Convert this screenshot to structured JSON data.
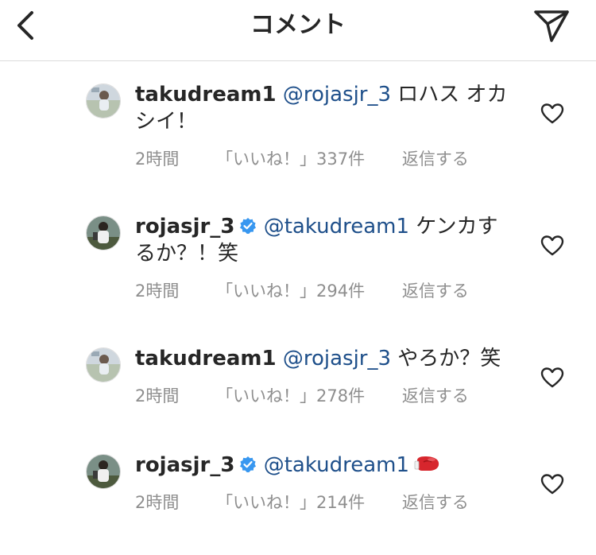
{
  "header": {
    "title": "コメント"
  },
  "comments": [
    {
      "username": "takudream1",
      "verified": false,
      "mention": "@rojasjr_3",
      "text": " ロハス オカシイ！",
      "time": "2時間",
      "likes": "「いいね！」337件",
      "reply": "返信する"
    },
    {
      "username": "rojasjr_3",
      "verified": true,
      "mention": "@takudream1",
      "text": " ケンカするか？！笑",
      "time": "2時間",
      "likes": "「いいね！」294件",
      "reply": "返信する"
    },
    {
      "username": "takudream1",
      "verified": false,
      "mention": "@rojasjr_3",
      "text": " やろか？笑",
      "time": "2時間",
      "likes": "「いいね！」278件",
      "reply": "返信する"
    },
    {
      "username": "rojasjr_3",
      "verified": true,
      "mention": "@takudream1",
      "text": "",
      "emoji": "boxing-glove-icon",
      "time": "2時間",
      "likes": "「いいね！」214件",
      "reply": "返信する"
    }
  ],
  "colors": {
    "text": "#262626",
    "mention": "#1e4f8a",
    "meta": "#8e8e8e",
    "verified": "#3897f0",
    "divider": "#dbdbdb"
  }
}
